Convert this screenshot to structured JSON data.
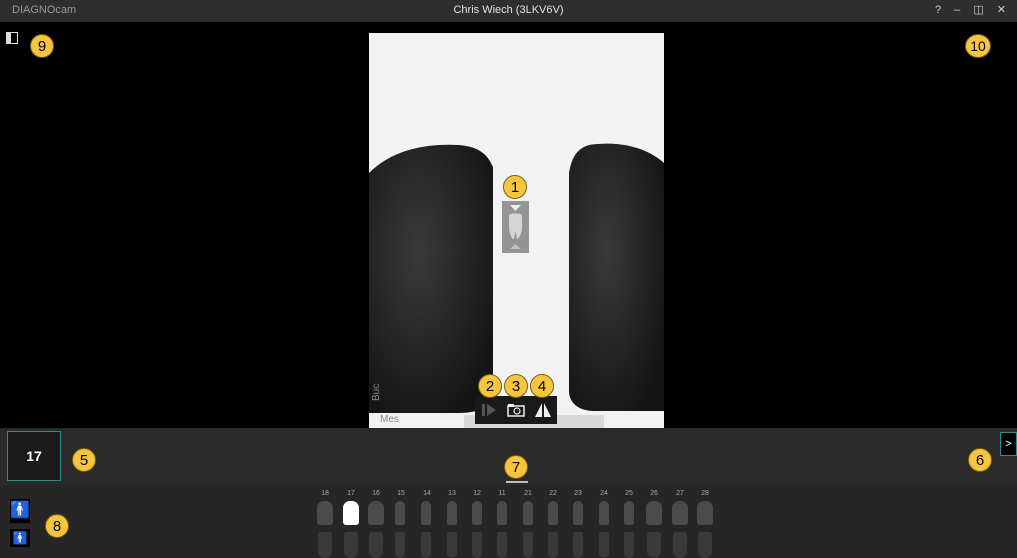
{
  "titlebar": {
    "app_name": "DIAGNOcam",
    "patient": "Chris Wiech (3LKV6V)",
    "controls": "? – ◫ ✕"
  },
  "image": {
    "surface_labels": [
      "Buc",
      "Mes"
    ]
  },
  "callouts": [
    "1",
    "2",
    "3",
    "4",
    "5",
    "6",
    "7",
    "8",
    "9",
    "10"
  ],
  "toolbar": {
    "icons": [
      "play-next-icon",
      "camera-folder-icon",
      "mirror-icon"
    ]
  },
  "selected_tooth": "17",
  "expand_label": ">",
  "dental_chart": {
    "upper_numbers": [
      "18",
      "17",
      "16",
      "15",
      "14",
      "13",
      "12",
      "11",
      "21",
      "22",
      "23",
      "24",
      "25",
      "26",
      "27",
      "28"
    ],
    "selected": "17"
  },
  "gender_icons": [
    "adult-male-icon",
    "child-icon"
  ],
  "colors": {
    "accent": "#2e8f8a",
    "callout": "#f6c540"
  }
}
